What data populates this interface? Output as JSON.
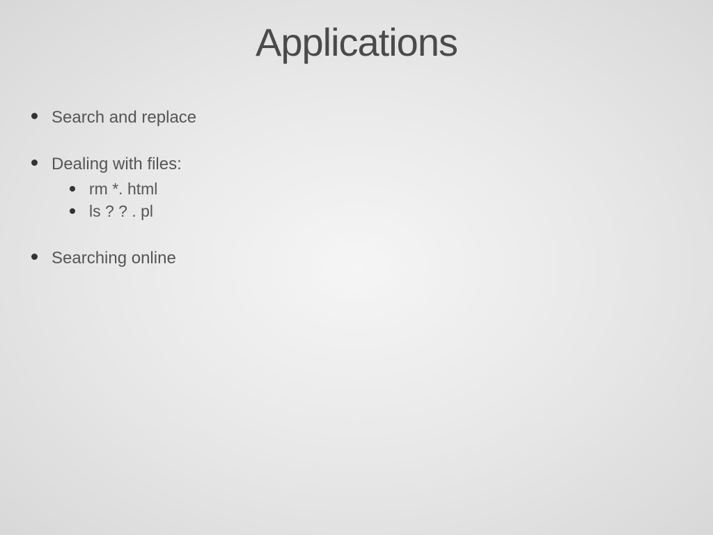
{
  "slide": {
    "title": "Applications",
    "bullets": [
      {
        "text": "Search and replace",
        "children": []
      },
      {
        "text": "Dealing with files:",
        "children": [
          "rm *. html",
          "ls ? ? . pl"
        ]
      },
      {
        "text": "Searching online",
        "children": []
      }
    ]
  }
}
